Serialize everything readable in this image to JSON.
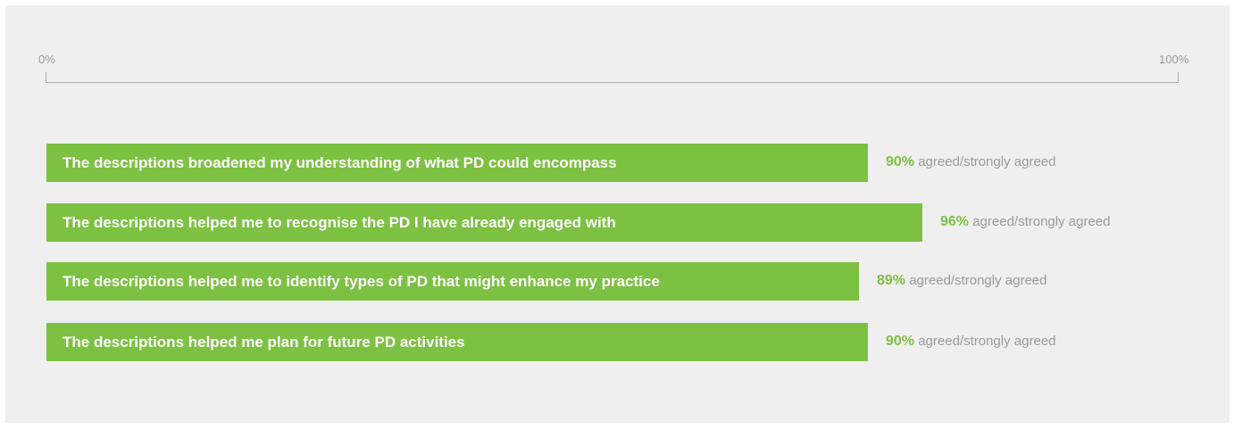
{
  "chart_data": {
    "type": "bar",
    "orientation": "horizontal",
    "axis": {
      "min_label": "0%",
      "max_label": "100%",
      "min": 0,
      "max": 100
    },
    "bar_color": "#7dc142",
    "value_suffix": "agreed/strongly agreed",
    "categories": [
      "The descriptions broadened my understanding of what PD could encompass",
      "The descriptions helped me to recognise the PD I have already engaged with",
      "The descriptions helped me to identify types of PD that might enhance my practice",
      "The descriptions helped me plan for future PD activities"
    ],
    "values": [
      90,
      96,
      89,
      90
    ],
    "value_labels": [
      "90%",
      "96%",
      "89%",
      "90%"
    ]
  }
}
